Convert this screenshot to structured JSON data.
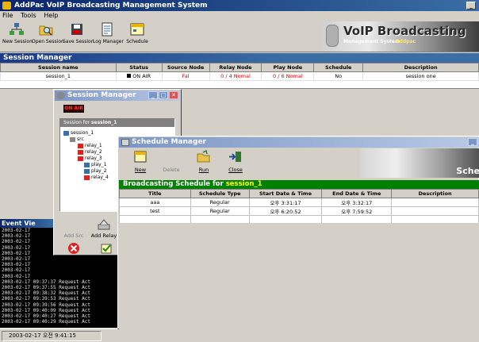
{
  "window": {
    "title": "AddPac VoIP Broadcasting Management System",
    "minimize": "_"
  },
  "menu": [
    "File",
    "Tools",
    "Help"
  ],
  "toolbar": {
    "new_session": "New Session",
    "open_session": "Open Session",
    "save_session": "Save Session",
    "log_manager": "Log Manager",
    "schedule": "Schedule"
  },
  "banner": {
    "line1": "VoIP Broadcasting",
    "line2": "Management System",
    "line3": "Addpac"
  },
  "session_manager": {
    "title": "Session Manager",
    "columns": [
      "Session name",
      "Status",
      "Source Node",
      "Relay Node",
      "Play Node",
      "Schedule",
      "Description"
    ],
    "rows": [
      {
        "name": "session_1",
        "status": "ON AIR",
        "source": "Fal",
        "relay": "0 / 4 Nomal",
        "play": "0 / 6 Nomal",
        "schedule": "No",
        "description": "session one"
      }
    ]
  },
  "event_viewer": {
    "title": "Event Vie",
    "lines": [
      "2003-02-17",
      "2003-02-17",
      "2003-02-17",
      "2003-02-17",
      "2003-02-17",
      "2003-02-17",
      "2003-02-17",
      "2003-02-17",
      "2003-02-17",
      "2003-02-17 09:37:37 Request  Act",
      "2003-02-17 09:37:55 Request  Act",
      "2003-02-17 09:38:32 Request  Act",
      "2003-02-17 09:39:53 Request  Act",
      "2003-02-17 09:39:56 Request  Act",
      "2003-02-17 09:40:09 Request  Act",
      "2003-02-17 09:40:27 Request  Act",
      "2003-02-17 09:40:29 Request  Act"
    ]
  },
  "status_bar": {
    "datetime": "2003-02-17 오전 9:41:15"
  },
  "session_dialog": {
    "title": "Session Manager",
    "onair": "ON AIR",
    "tree_header_prefix": "Session for ",
    "tree_header_session": "session_1",
    "tree": {
      "root": "session_1",
      "src": "src",
      "relays": [
        "relay_1",
        "relay_2",
        "relay_3"
      ],
      "plays": [
        "play_1",
        "play_2"
      ],
      "relay4": "relay_4"
    },
    "buttons": {
      "add_src": "Add Src",
      "add_relay": "Add Relay",
      "delete": "Delete",
      "check_node": "Check Node"
    },
    "window_buttons": {
      "min": "_",
      "max": "□",
      "close": "✕"
    }
  },
  "schedule_dialog": {
    "title": "Schedule Manager",
    "banner_text": "Sche",
    "buttons": {
      "new": "New",
      "delete": "Delete",
      "run": "Run",
      "close": "Close"
    },
    "header_prefix": "Broadcasting Schedule for ",
    "header_session": "session_1",
    "columns": [
      "Title",
      "Schedule Type",
      "Start Date & Time",
      "End Date & Time",
      "Description"
    ],
    "rows": [
      {
        "title": "aaa",
        "type": "Regular",
        "start": "오후 3:31:17",
        "end": "오후 3:32:17",
        "description": ""
      },
      {
        "title": "test",
        "type": "Regular",
        "start": "오후 6:20:52",
        "end": "오후 7:59:52",
        "description": ""
      },
      {
        "title": "",
        "type": "",
        "start": "",
        "end": "",
        "description": ""
      }
    ],
    "window_buttons": {
      "min": "_"
    }
  },
  "colors": {
    "title_blue": "#0a246a",
    "schedule_green": "#008000",
    "alert_red": "#e00000"
  }
}
